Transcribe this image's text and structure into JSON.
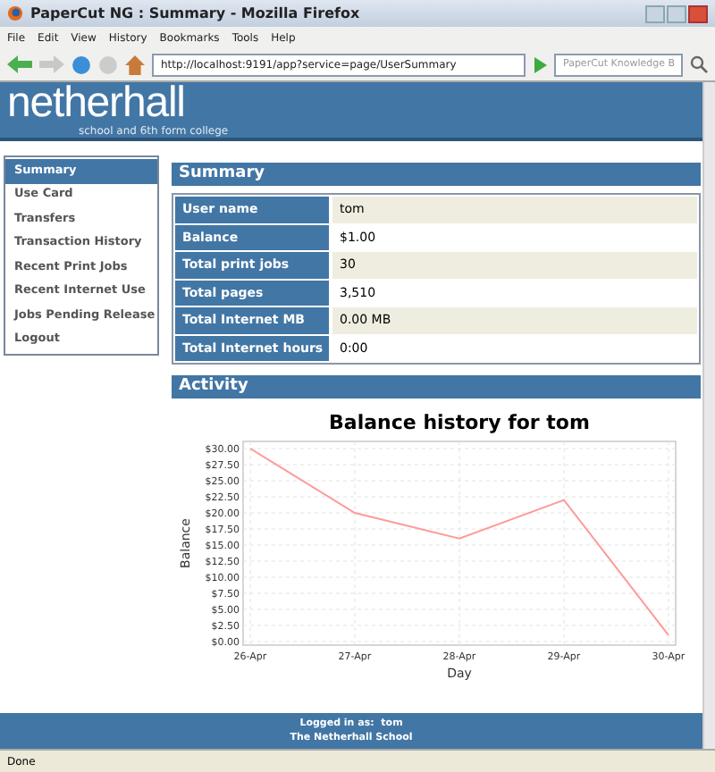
{
  "window": {
    "title": "PaperCut NG : Summary - Mozilla Firefox"
  },
  "menu": [
    "File",
    "Edit",
    "View",
    "History",
    "Bookmarks",
    "Tools",
    "Help"
  ],
  "address": {
    "value": "http://localhost:9191/app?service=page/UserSummary"
  },
  "search": {
    "placeholder": "PaperCut Knowledge B"
  },
  "banner": {
    "logo": "netherhall",
    "tagline": "school and 6th form college"
  },
  "nav": [
    {
      "label": "Summary",
      "selected": true
    },
    {
      "label": "Use Card",
      "selected": false
    },
    {
      "label": "Transfers",
      "selected": false
    },
    {
      "label": "Transaction History",
      "selected": false
    },
    {
      "label": "Recent Print Jobs",
      "selected": false
    },
    {
      "label": "Recent Internet Use",
      "selected": false
    },
    {
      "label": "Jobs Pending Release",
      "selected": false
    },
    {
      "label": "Logout",
      "selected": false
    }
  ],
  "summary": {
    "title": "Summary",
    "rows": [
      {
        "label": "User name",
        "value": "tom"
      },
      {
        "label": "Balance",
        "value": "$1.00"
      },
      {
        "label": "Total print jobs",
        "value": "30"
      },
      {
        "label": "Total pages",
        "value": "3,510"
      },
      {
        "label": "Total Internet MB",
        "value": "0.00 MB"
      },
      {
        "label": "Total Internet hours",
        "value": "0:00"
      }
    ]
  },
  "activity": {
    "title": "Activity",
    "chart_data": {
      "type": "line",
      "title": "Balance history for tom",
      "xlabel": "Day",
      "ylabel": "Balance",
      "categories": [
        "26-Apr",
        "27-Apr",
        "28-Apr",
        "29-Apr",
        "30-Apr"
      ],
      "series": [
        {
          "color": "#ff9999",
          "values": [
            30,
            20,
            16,
            22,
            1
          ]
        }
      ],
      "grid": true,
      "ylim": [
        0,
        30
      ],
      "yticks": [
        {
          "value": 0,
          "label": "$0.00"
        },
        {
          "value": 2.5,
          "label": "$2.50"
        },
        {
          "value": 5,
          "label": "$5.00"
        },
        {
          "value": 7.5,
          "label": "$7.50"
        },
        {
          "value": 10,
          "label": "$10.00"
        },
        {
          "value": 12.5,
          "label": "$12.50"
        },
        {
          "value": 15,
          "label": "$15.00"
        },
        {
          "value": 17.5,
          "label": "$17.50"
        },
        {
          "value": 20,
          "label": "$20.00"
        },
        {
          "value": 22.5,
          "label": "$22.50"
        },
        {
          "value": 25,
          "label": "$25.00"
        },
        {
          "value": 27.5,
          "label": "$27.50"
        },
        {
          "value": 30,
          "label": "$30.00"
        }
      ]
    }
  },
  "footer": {
    "logged_in_label": "Logged in as:",
    "user": "tom",
    "school": "The Netherhall School"
  },
  "status_bar": "Done"
}
